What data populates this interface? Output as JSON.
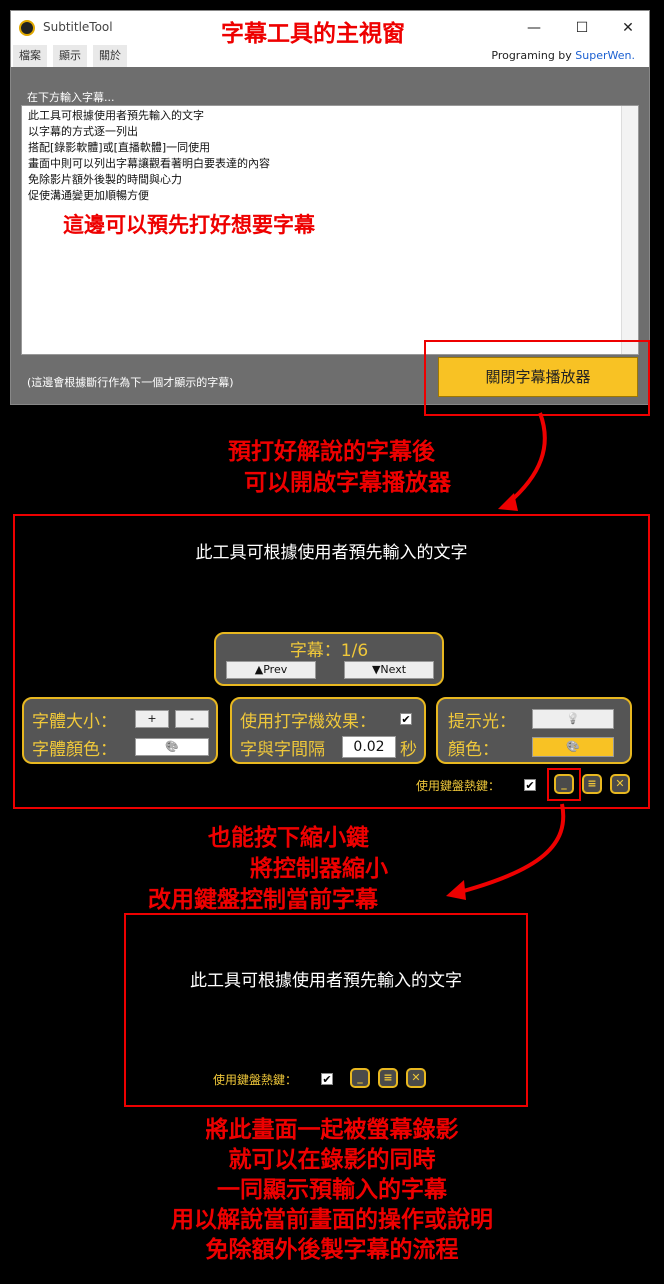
{
  "window": {
    "app_title": "SubtitleTool",
    "annotation_title": "字幕工具的主視窗",
    "controls": {
      "minimize": "—",
      "maximize": "☐",
      "close": "✕"
    },
    "menu": [
      "檔案",
      "顯示",
      "關於"
    ],
    "credit_prefix": "Programing by ",
    "credit_name": "SuperWen."
  },
  "editor": {
    "label": "在下方輸入字幕...",
    "lines": [
      "此工具可根據使用者預先輸入的文字",
      "以字幕的方式逐一列出",
      "搭配[錄影軟體]或[直播軟體]一同使用",
      "畫面中則可以列出字幕讓觀看著明白要表達的內容",
      "免除影片額外後製的時間與心力",
      "促使溝通變更加順暢方便"
    ],
    "annotation": "這邊可以預先打好想要字幕",
    "footer_note": "(這邊會根據斷行作為下一個才顯示的字幕)",
    "close_player_label": "關閉字幕播放器"
  },
  "annotations": {
    "open_player": [
      "預打好解說的字幕後",
      "可以開啟字幕播放器"
    ],
    "minimize": [
      "也能按下縮小鍵",
      "將控制器縮小",
      "改用鍵盤控制當前字幕"
    ],
    "summary": [
      "將此畫面一起被螢幕錄影",
      "就可以在錄影的同時",
      "一同顯示預輸入的字幕",
      "用以解說當前畫面的操作或說明",
      "免除額外後製字幕的流程"
    ]
  },
  "player": {
    "subtitle": "此工具可根據使用者預先輸入的文字",
    "counter_label": "字幕：1/6",
    "prev_label": "▲Prev",
    "next_label": "▼Next",
    "font_size_label": "字體大小：",
    "font_plus": "+",
    "font_minus": "-",
    "font_color_label": "字體顏色：",
    "typewriter_label": "使用打字機效果：",
    "typewriter_checked": "✔",
    "interval_label": "字與字間隔",
    "interval_value": "0.02",
    "interval_unit": "秒",
    "hint_light_label": "提示光：",
    "color_label": "顏色：",
    "light_icon": "💡",
    "palette_icon": "🎨",
    "hotkey_label": "使用鍵盤熱鍵：",
    "hotkey_checked": "✔",
    "minimize_glyph": "_",
    "menu_glyph": "≡",
    "close_glyph": "✕",
    "accent": "#e8b820",
    "color_swatch": "#f8c224"
  },
  "mini_player": {
    "subtitle": "此工具可根據使用者預先輸入的文字",
    "hotkey_label": "使用鍵盤熱鍵：",
    "hotkey_checked": "✔",
    "minimize_glyph": "_",
    "menu_glyph": "≡",
    "close_glyph": "✕"
  }
}
